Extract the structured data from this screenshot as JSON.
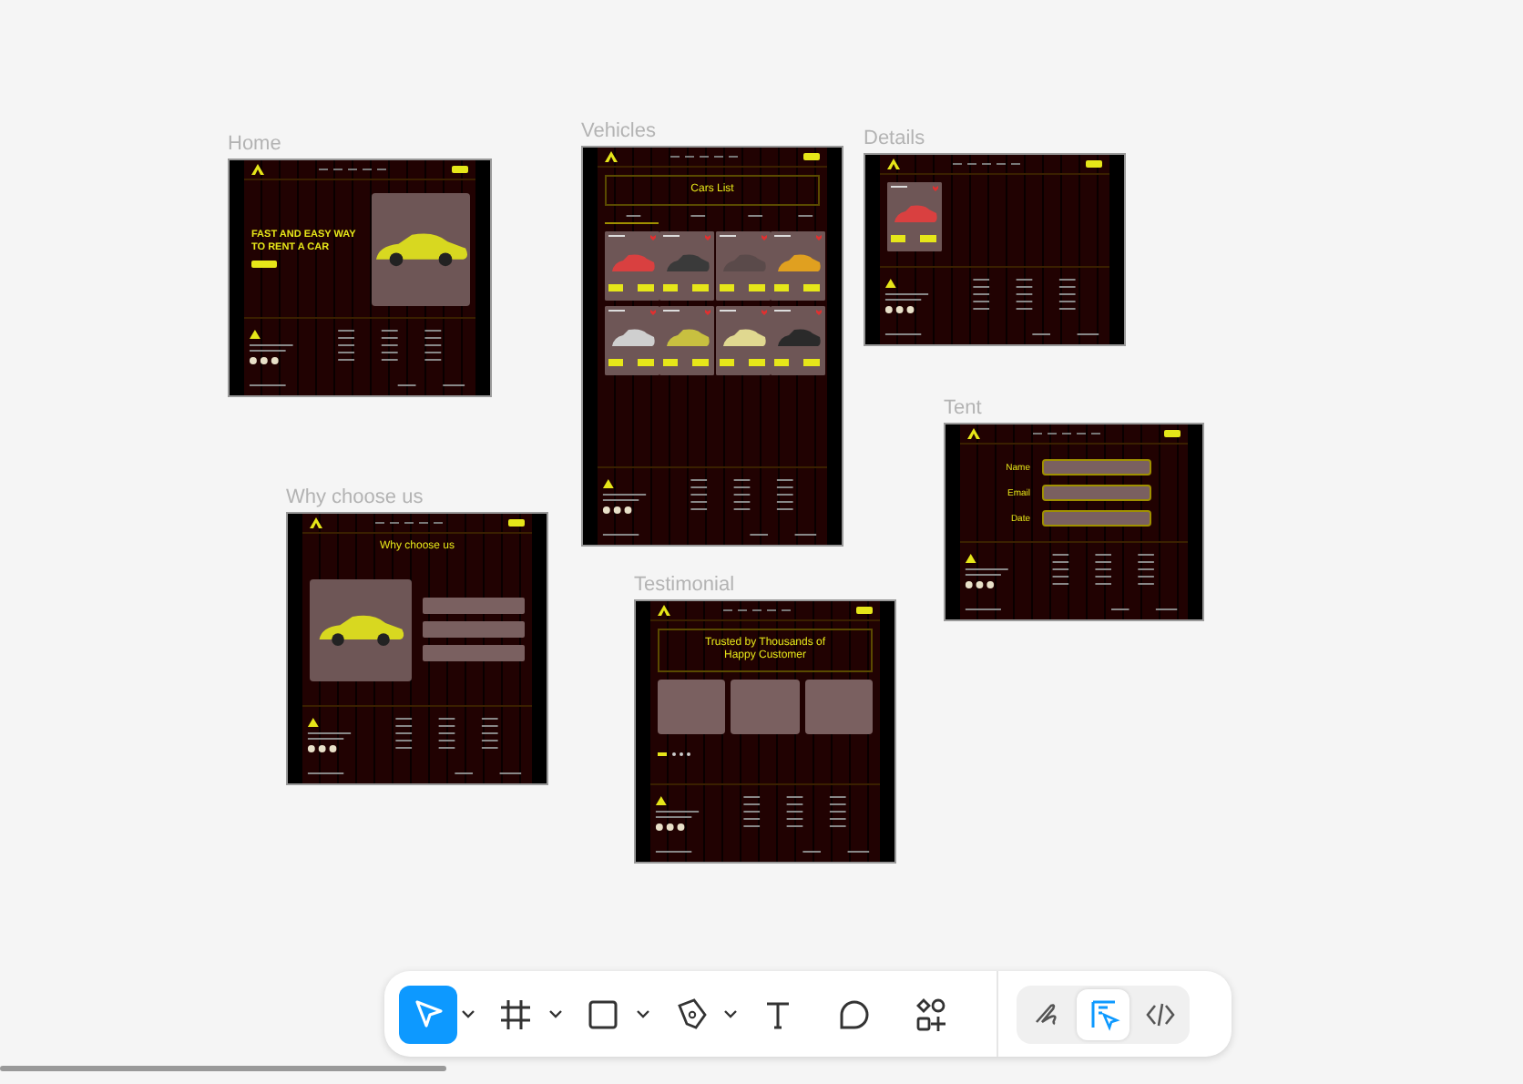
{
  "frames": [
    {
      "kind": "home",
      "title": "Home",
      "headline": "FAST AND EASY WAY TO RENT A CAR"
    },
    {
      "kind": "vehicles",
      "title": "Vehicles",
      "heading": "Cars List"
    },
    {
      "kind": "details",
      "title": "Details"
    },
    {
      "kind": "why",
      "title": "Why choose us",
      "heading": "Why choose us"
    },
    {
      "kind": "testimonial",
      "title": "Testimonial",
      "heading": "Trusted by Thousands of Happy Customer"
    },
    {
      "kind": "form",
      "title": "Tent",
      "fields": [
        "Name",
        "Email",
        "Date"
      ]
    }
  ],
  "toolbar": {
    "tools": [
      {
        "kind": "move",
        "selected": true,
        "dropdown": true
      },
      {
        "kind": "frame",
        "selected": false,
        "dropdown": true
      },
      {
        "kind": "rectangle",
        "selected": false,
        "dropdown": true
      },
      {
        "kind": "pen",
        "selected": false,
        "dropdown": true
      },
      {
        "kind": "text",
        "selected": false,
        "dropdown": false
      },
      {
        "kind": "comment",
        "selected": false,
        "dropdown": false
      },
      {
        "kind": "shapes",
        "selected": false,
        "dropdown": false
      }
    ],
    "modes": [
      {
        "kind": "draw",
        "selected": false
      },
      {
        "kind": "design",
        "selected": true
      },
      {
        "kind": "code",
        "selected": false
      }
    ]
  }
}
